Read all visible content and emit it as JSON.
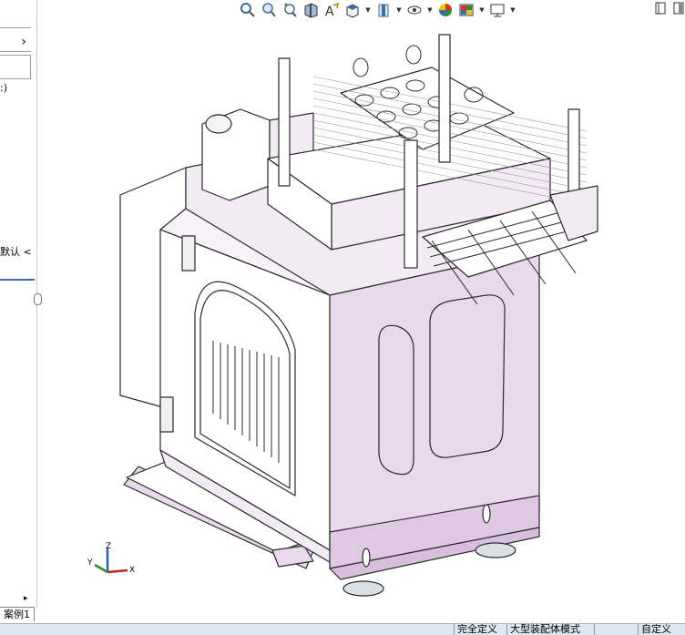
{
  "toolbar": {
    "icons": [
      "zoom-to-fit",
      "zoom-area",
      "previous-view",
      "section-view",
      "dynamic-annotation",
      "view-orientation",
      "display-style",
      "hide-show-items",
      "edit-appearance",
      "apply-scene",
      "view-settings"
    ]
  },
  "left_panel": {
    "collapse_glyph": "›",
    "line1": ":)",
    "line2": "默认 <",
    "scroll_glyph": "▸"
  },
  "bottom_tab": {
    "label": "案例1"
  },
  "triad": {
    "x": "X",
    "y": "Y",
    "z": "Z"
  },
  "statusbar": {
    "cell1": "完全定义",
    "cell2": "大型装配体模式",
    "cell3": "",
    "cell4": "自定义"
  },
  "colors": {
    "accent": "#3d6ea8",
    "model_fill": "#ead8ec",
    "line": "#2a2a2a"
  }
}
